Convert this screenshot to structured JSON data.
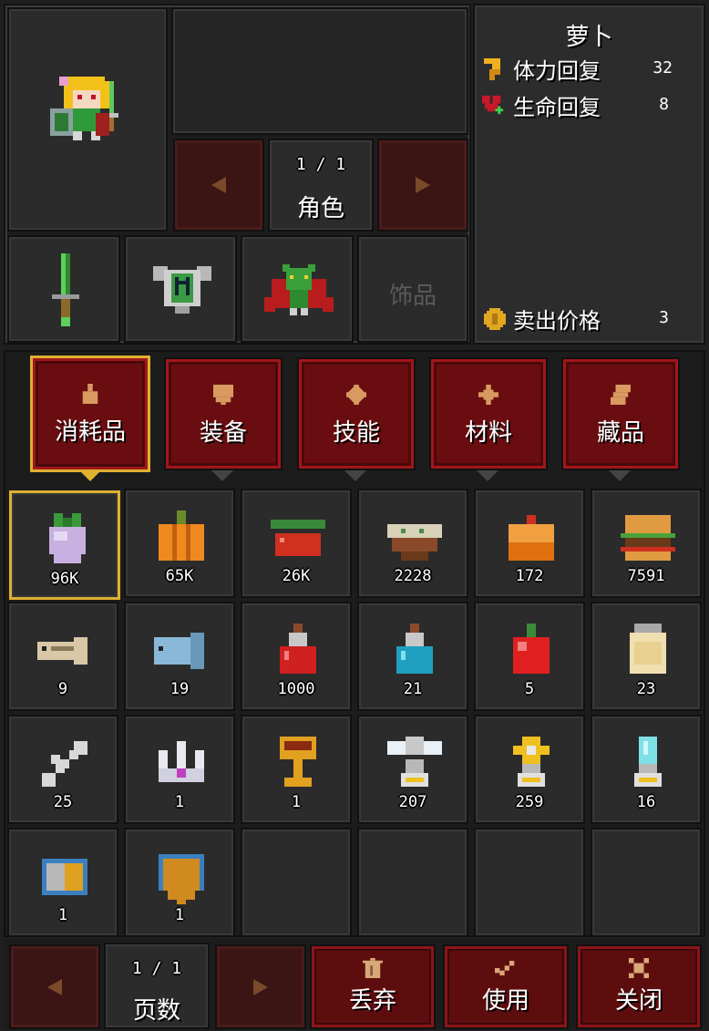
{
  "character": {
    "page_indicator": "1 / 1",
    "label": "角色",
    "accessory_label": "饰品"
  },
  "item_info": {
    "name": "萝卜",
    "stats": [
      {
        "icon": "stamina-icon",
        "label": "体力回复",
        "value": "32"
      },
      {
        "icon": "heart-plus-icon",
        "label": "生命回复",
        "value": "8"
      }
    ],
    "sell_label": "卖出价格",
    "sell_value": "3"
  },
  "tabs": [
    {
      "label": "消耗品",
      "icon": "potion-icon",
      "active": true
    },
    {
      "label": "装备",
      "icon": "shield-icon",
      "active": false
    },
    {
      "label": "技能",
      "icon": "diamond-icon",
      "active": false
    },
    {
      "label": "材料",
      "icon": "cross-icon",
      "active": false
    },
    {
      "label": "藏品",
      "icon": "scroll-icon",
      "active": false
    }
  ],
  "inventory": [
    {
      "icon": "turnip-icon",
      "count": "96K"
    },
    {
      "icon": "pumpkin-icon",
      "count": "65K"
    },
    {
      "icon": "cherry-icon",
      "count": "26K"
    },
    {
      "icon": "soup-bowl-icon",
      "count": "2228"
    },
    {
      "icon": "cake-icon",
      "count": "172"
    },
    {
      "icon": "burger-icon",
      "count": "7591"
    },
    {
      "icon": "bone-fish-icon",
      "count": "9"
    },
    {
      "icon": "blue-fish-icon",
      "count": "19"
    },
    {
      "icon": "red-potion-icon",
      "count": "1000"
    },
    {
      "icon": "blue-potion-icon",
      "count": "21"
    },
    {
      "icon": "apple-icon",
      "count": "5"
    },
    {
      "icon": "jar-icon",
      "count": "23"
    },
    {
      "icon": "bone-icon",
      "count": "25"
    },
    {
      "icon": "crown-icon",
      "count": "1"
    },
    {
      "icon": "chalice-icon",
      "count": "1"
    },
    {
      "icon": "winged-trophy-icon",
      "count": "207"
    },
    {
      "icon": "star-trophy-icon",
      "count": "259"
    },
    {
      "icon": "crystal-trophy-icon",
      "count": "16"
    },
    {
      "icon": "silver-ingot-icon",
      "count": "1"
    },
    {
      "icon": "gold-shield-icon",
      "count": "1"
    }
  ],
  "footer": {
    "page_indicator": "1 / 1",
    "page_label": "页数",
    "discard_label": "丢弃",
    "use_label": "使用",
    "close_label": "关闭"
  }
}
